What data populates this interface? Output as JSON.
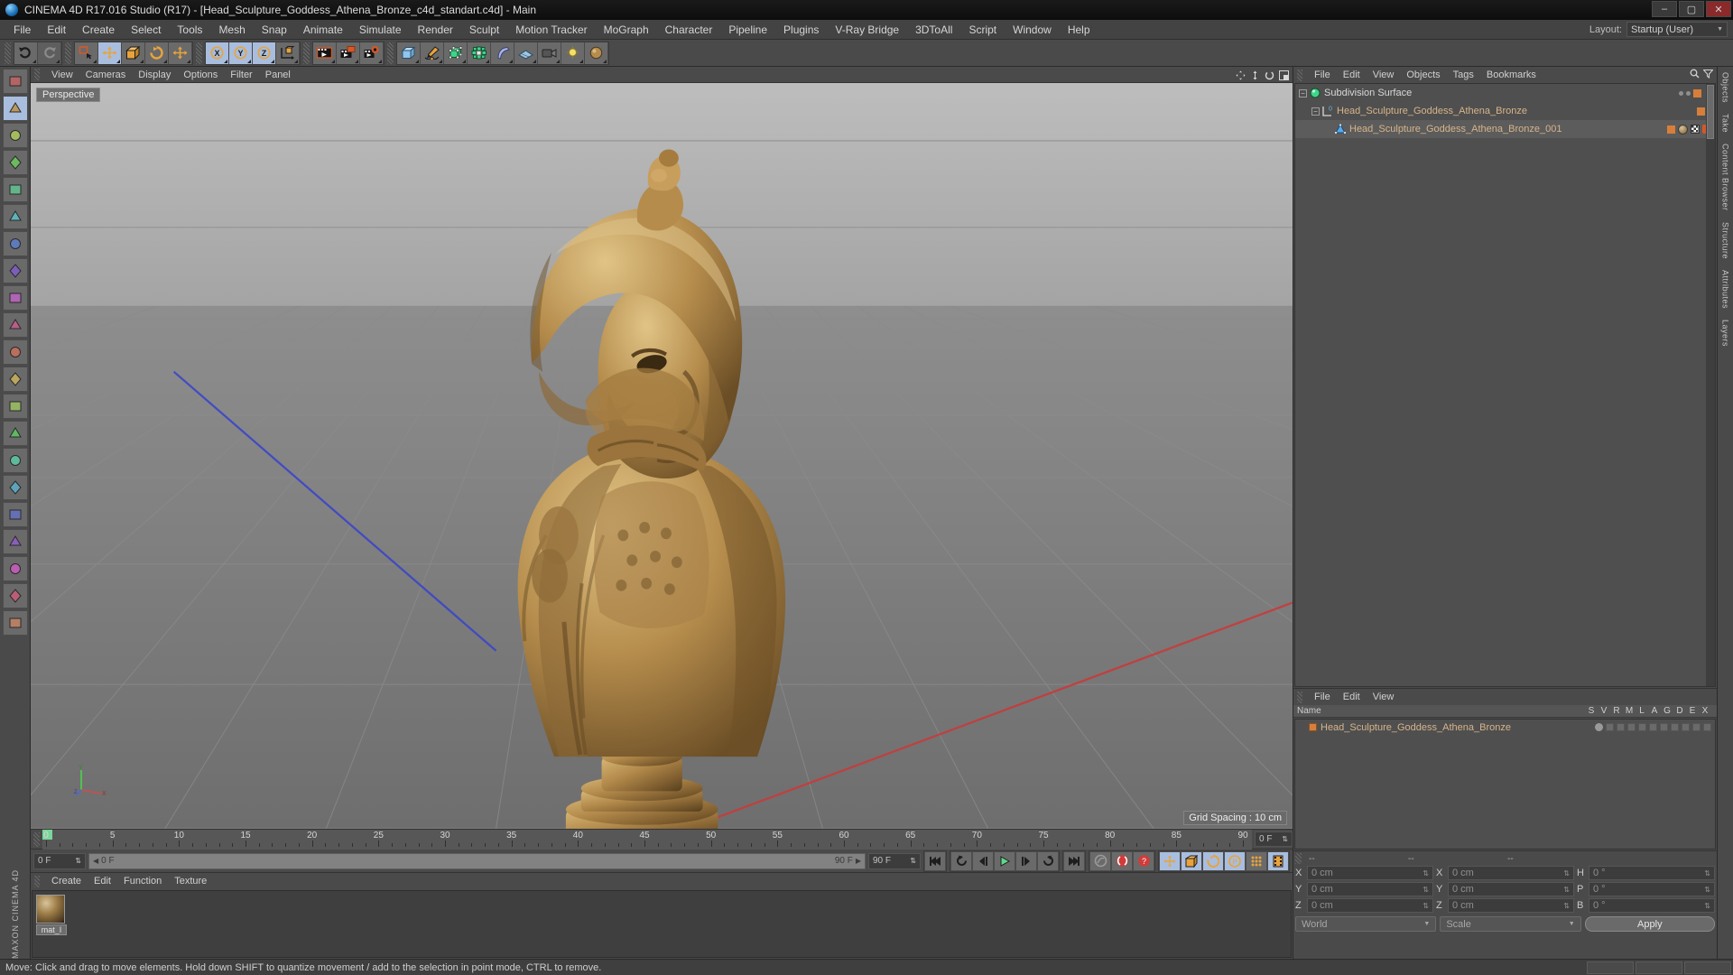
{
  "window": {
    "title": "CINEMA 4D R17.016 Studio (R17) - [Head_Sculpture_Goddess_Athena_Bronze_c4d_standart.c4d] - Main",
    "minimize": "–",
    "maximize": "▢",
    "close": "✕"
  },
  "menubar": {
    "items": [
      "File",
      "Edit",
      "Create",
      "Select",
      "Tools",
      "Mesh",
      "Snap",
      "Animate",
      "Simulate",
      "Render",
      "Sculpt",
      "Motion Tracker",
      "MoGraph",
      "Character",
      "Pipeline",
      "Plugins",
      "V-Ray Bridge",
      "3DToAll",
      "Script",
      "Window",
      "Help"
    ],
    "layout_label": "Layout:",
    "layout_value": "Startup (User)",
    "layout_caret": "▼"
  },
  "toolbar": {
    "groups": [
      {
        "name": "undo-redo",
        "buttons": [
          {
            "name": "undo-button",
            "icon": "undo-icon",
            "state": "normal"
          },
          {
            "name": "redo-button",
            "icon": "redo-icon",
            "state": "disabled"
          }
        ]
      },
      {
        "name": "select-transform",
        "buttons": [
          {
            "name": "live-selection-button",
            "icon": "live-selection-icon",
            "state": "normal"
          },
          {
            "name": "move-tool-button",
            "icon": "move-icon",
            "state": "active"
          },
          {
            "name": "scale-tool-button",
            "icon": "scale-icon",
            "state": "normal"
          },
          {
            "name": "rotate-tool-button",
            "icon": "rotate-icon",
            "state": "normal"
          },
          {
            "name": "move-alt-button",
            "icon": "move-icon",
            "state": "normal"
          }
        ]
      },
      {
        "name": "axis-locks",
        "buttons": [
          {
            "name": "lock-x-button",
            "icon": "x-axis-icon",
            "state": "active"
          },
          {
            "name": "lock-y-button",
            "icon": "y-axis-icon",
            "state": "active"
          },
          {
            "name": "lock-z-button",
            "icon": "z-axis-icon",
            "state": "active"
          },
          {
            "name": "world-coordinates-button",
            "icon": "world-axis-icon",
            "state": "normal"
          }
        ]
      },
      {
        "name": "render-group",
        "buttons": [
          {
            "name": "render-view-button",
            "icon": "render-view-icon",
            "state": "normal"
          },
          {
            "name": "render-region-button",
            "icon": "render-region-icon",
            "state": "normal"
          },
          {
            "name": "render-settings-button",
            "icon": "render-settings-icon",
            "state": "normal"
          }
        ]
      },
      {
        "name": "object-group",
        "buttons": [
          {
            "name": "add-cube-button",
            "icon": "cube-icon",
            "state": "normal"
          },
          {
            "name": "add-spline-button",
            "icon": "pen-spline-icon",
            "state": "normal"
          },
          {
            "name": "add-nurbs-button",
            "icon": "hypernurbs-icon",
            "state": "normal"
          },
          {
            "name": "add-array-button",
            "icon": "array-icon",
            "state": "normal"
          },
          {
            "name": "add-deformer-button",
            "icon": "bend-deformer-icon",
            "state": "normal"
          },
          {
            "name": "add-environment-button",
            "icon": "floor-icon",
            "state": "normal"
          },
          {
            "name": "add-camera-button",
            "icon": "camera-icon",
            "state": "normal"
          },
          {
            "name": "add-light-button",
            "icon": "light-icon",
            "state": "normal"
          },
          {
            "name": "add-material-button",
            "icon": "material-icon",
            "state": "normal"
          }
        ]
      }
    ]
  },
  "leftrail": {
    "buttons": [
      {
        "name": "texture-axis-tool",
        "icon": "texture-axis-icon"
      },
      {
        "name": "model-mode-tool",
        "icon": "model-mode-icon"
      },
      {
        "name": "object-axis-tool",
        "icon": "object-axis-icon"
      },
      {
        "name": "texture-mode-tool",
        "icon": "texture-mode-icon"
      },
      {
        "name": "point-mode-tool",
        "icon": "point-mode-icon"
      },
      {
        "name": "edge-mode-tool",
        "icon": "edge-mode-icon"
      },
      {
        "name": "polygon-mode-tool",
        "icon": "polygon-mode-icon"
      },
      {
        "name": "workplane-tool",
        "icon": "workplane-icon"
      },
      {
        "name": "magnet-tool",
        "icon": "magnet-icon"
      },
      {
        "name": "snap-tool",
        "icon": "snap-icon"
      },
      {
        "name": "brush-tool",
        "icon": "brush-icon"
      },
      {
        "name": "measure-tool",
        "icon": "measure-icon"
      },
      {
        "name": "axis-lock-x",
        "icon": "lock-x-icon"
      },
      {
        "name": "axis-lock-y",
        "icon": "lock-y-icon"
      },
      {
        "name": "axis-lock-z",
        "icon": "lock-z-icon"
      },
      {
        "name": "axis-lock-all",
        "icon": "lock-all-icon"
      },
      {
        "name": "enable-axis-tool",
        "icon": "enable-axis-icon"
      },
      {
        "name": "viewport-solo",
        "icon": "viewport-solo-icon"
      },
      {
        "name": "lock-workplane",
        "icon": "lock-workplane-icon"
      },
      {
        "name": "quantize-tool",
        "icon": "quantize-icon"
      },
      {
        "name": "layout-presets",
        "icon": "layout-presets-icon"
      }
    ],
    "brand_line1": "CINEMA 4D",
    "brand_line2": "MAXON"
  },
  "viewport": {
    "menu": [
      "View",
      "Cameras",
      "Display",
      "Options",
      "Filter",
      "Panel"
    ],
    "label": "Perspective",
    "grid_spacing": "Grid Spacing : 10 cm",
    "icons": [
      {
        "name": "viewport-move-icon"
      },
      {
        "name": "viewport-zoom-icon"
      },
      {
        "name": "viewport-rotate-icon"
      },
      {
        "name": "viewport-maximize-icon"
      }
    ],
    "axis": {
      "x": "X",
      "y": "Y",
      "z": "Z"
    }
  },
  "timeline": {
    "ticks": [
      "0",
      "5",
      "10",
      "15",
      "20",
      "25",
      "30",
      "35",
      "40",
      "45",
      "50",
      "55",
      "60",
      "65",
      "70",
      "75",
      "80",
      "85",
      "90"
    ],
    "current_frame_field": "0 F",
    "start_field": "0 F",
    "preview_start": "0 F",
    "preview_end": "90 F",
    "end_field": "90 F",
    "buttons": [
      {
        "name": "go-to-start-button",
        "icon": "go-to-start-icon"
      },
      {
        "name": "previous-key-button",
        "icon": "previous-key-icon"
      },
      {
        "name": "step-back-button",
        "icon": "step-back-icon"
      },
      {
        "name": "play-button",
        "icon": "play-icon"
      },
      {
        "name": "step-forward-button",
        "icon": "step-forward-icon"
      },
      {
        "name": "next-key-button",
        "icon": "next-key-icon"
      },
      {
        "name": "go-to-end-button",
        "icon": "go-to-end-icon"
      }
    ],
    "record_buttons": [
      {
        "name": "autokey-button",
        "icon": "autokey-icon"
      },
      {
        "name": "record-active-button",
        "icon": "record-icon"
      },
      {
        "name": "keyframe-selection-button",
        "icon": "keyframe-question-icon"
      }
    ],
    "track_buttons": [
      {
        "name": "record-position-button",
        "icon": "position-icon"
      },
      {
        "name": "record-scale-button",
        "icon": "scale-icon"
      },
      {
        "name": "record-rotation-button",
        "icon": "rotation-icon"
      },
      {
        "name": "record-param-button",
        "icon": "param-p-icon"
      },
      {
        "name": "point-level-animation-button",
        "icon": "pla-dots-icon"
      },
      {
        "name": "keyframe-mode-button",
        "icon": "keyframe-mode-icon"
      }
    ]
  },
  "materials": {
    "menu": [
      "Create",
      "Edit",
      "Function",
      "Texture"
    ],
    "items": [
      {
        "name": "mat_I",
        "preview": "bronze-sphere"
      }
    ]
  },
  "objects_panel": {
    "menu": [
      "File",
      "Edit",
      "View",
      "Objects",
      "Tags",
      "Bookmarks"
    ],
    "header_icons": [
      {
        "name": "objects-search-icon"
      },
      {
        "name": "objects-filter-icon"
      }
    ],
    "tree": [
      {
        "name": "Subdivision Surface",
        "depth": 0,
        "icon": "subdivision-surface-icon",
        "color": "white",
        "expanded": true
      },
      {
        "name": "Head_Sculpture_Goddess_Athena_Bronze",
        "depth": 1,
        "icon": "null-object-icon",
        "color": "tan",
        "expanded": true
      },
      {
        "name": "Head_Sculpture_Goddess_Athena_Bronze_001",
        "depth": 2,
        "icon": "polygon-object-icon",
        "color": "tan",
        "expanded": false,
        "selected": true
      }
    ]
  },
  "layer_panel": {
    "menu": [
      "File",
      "Edit",
      "View"
    ],
    "columns": [
      "Name",
      "S",
      "V",
      "R",
      "M",
      "L",
      "A",
      "G",
      "D",
      "E",
      "X"
    ],
    "rows": [
      {
        "name": "Head_Sculpture_Goddess_Athena_Bronze",
        "color": "#d77f3a"
      }
    ]
  },
  "coordinates": {
    "headers": [
      "--",
      "--",
      "--"
    ],
    "rows": [
      {
        "label_pos": "X",
        "pos": "0 cm",
        "label_size": "X",
        "size": "0 cm",
        "label_rot": "H",
        "rot": "0 °"
      },
      {
        "label_pos": "Y",
        "pos": "0 cm",
        "label_size": "Y",
        "size": "0 cm",
        "label_rot": "P",
        "rot": "0 °"
      },
      {
        "label_pos": "Z",
        "pos": "0 cm",
        "label_size": "Z",
        "size": "0 cm",
        "label_rot": "B",
        "rot": "0 °"
      }
    ],
    "system": "World",
    "mode": "Scale",
    "apply": "Apply",
    "caret": "▼"
  },
  "side_tabs": [
    "Objects",
    "Take",
    "Content Browser",
    "Structure",
    "Attributes",
    "Layers"
  ],
  "statusbar": {
    "message": "Move: Click and drag to move elements. Hold down SHIFT to quantize movement / add to the selection in point mode, CTRL to remove."
  },
  "colors": {
    "accent_orange": "#e8a33d",
    "active_blue": "#a9bede",
    "panel_bg": "#4a4a4a",
    "tree_text": "#d6b48a",
    "green_key": "#7ad69b",
    "red_record": "#d43a3a"
  }
}
